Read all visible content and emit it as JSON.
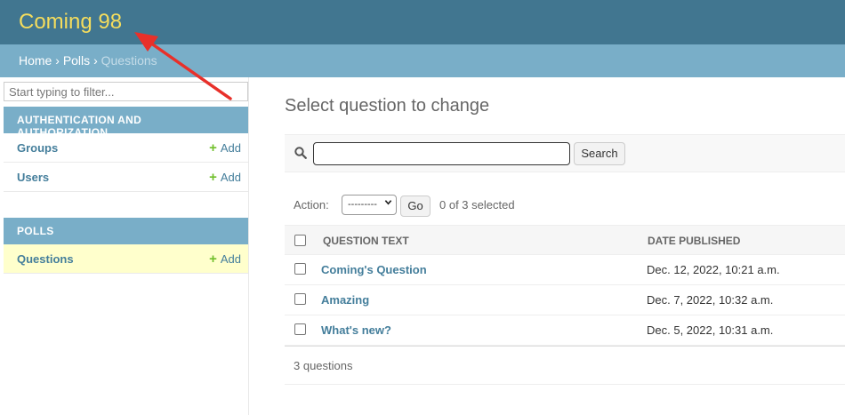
{
  "header": {
    "site_name": "Coming 98"
  },
  "breadcrumbs": {
    "home": "Home",
    "sep1": "›",
    "app": "Polls",
    "sep2": "›",
    "current": "Questions"
  },
  "sidebar": {
    "filter_placeholder": "Start typing to filter...",
    "modules": [
      {
        "caption": "AUTHENTICATION AND AUTHORIZATION",
        "models": [
          {
            "name": "Groups",
            "add": "Add"
          },
          {
            "name": "Users",
            "add": "Add"
          }
        ]
      },
      {
        "caption": "POLLS",
        "models": [
          {
            "name": "Questions",
            "add": "Add"
          }
        ]
      }
    ]
  },
  "content": {
    "title": "Select question to change",
    "search_button": "Search",
    "search_value": "",
    "action_label": "Action:",
    "action_selected": "---------",
    "go_button": "Go",
    "selected_count": "0 of 3 selected",
    "columns": [
      "QUESTION TEXT",
      "DATE PUBLISHED"
    ],
    "rows": [
      {
        "question": "Coming's Question",
        "date": "Dec. 12, 2022, 10:21 a.m."
      },
      {
        "question": "Amazing",
        "date": "Dec. 7, 2022, 10:32 a.m."
      },
      {
        "question": "What's new?",
        "date": "Dec. 5, 2022, 10:31 a.m."
      }
    ],
    "paginator": "3 questions"
  },
  "colors": {
    "header_bg": "#417690",
    "site_name": "#f5dd5d",
    "breadcrumb_bg": "#79aec8",
    "link": "#447e9b",
    "add_plus": "#70bf2b",
    "current_row": "#ffffcc",
    "annotation_arrow": "#e8302a"
  },
  "icons": {
    "search": "magnifier-icon",
    "add": "plus-icon",
    "annotation": "red-arrow-icon"
  }
}
